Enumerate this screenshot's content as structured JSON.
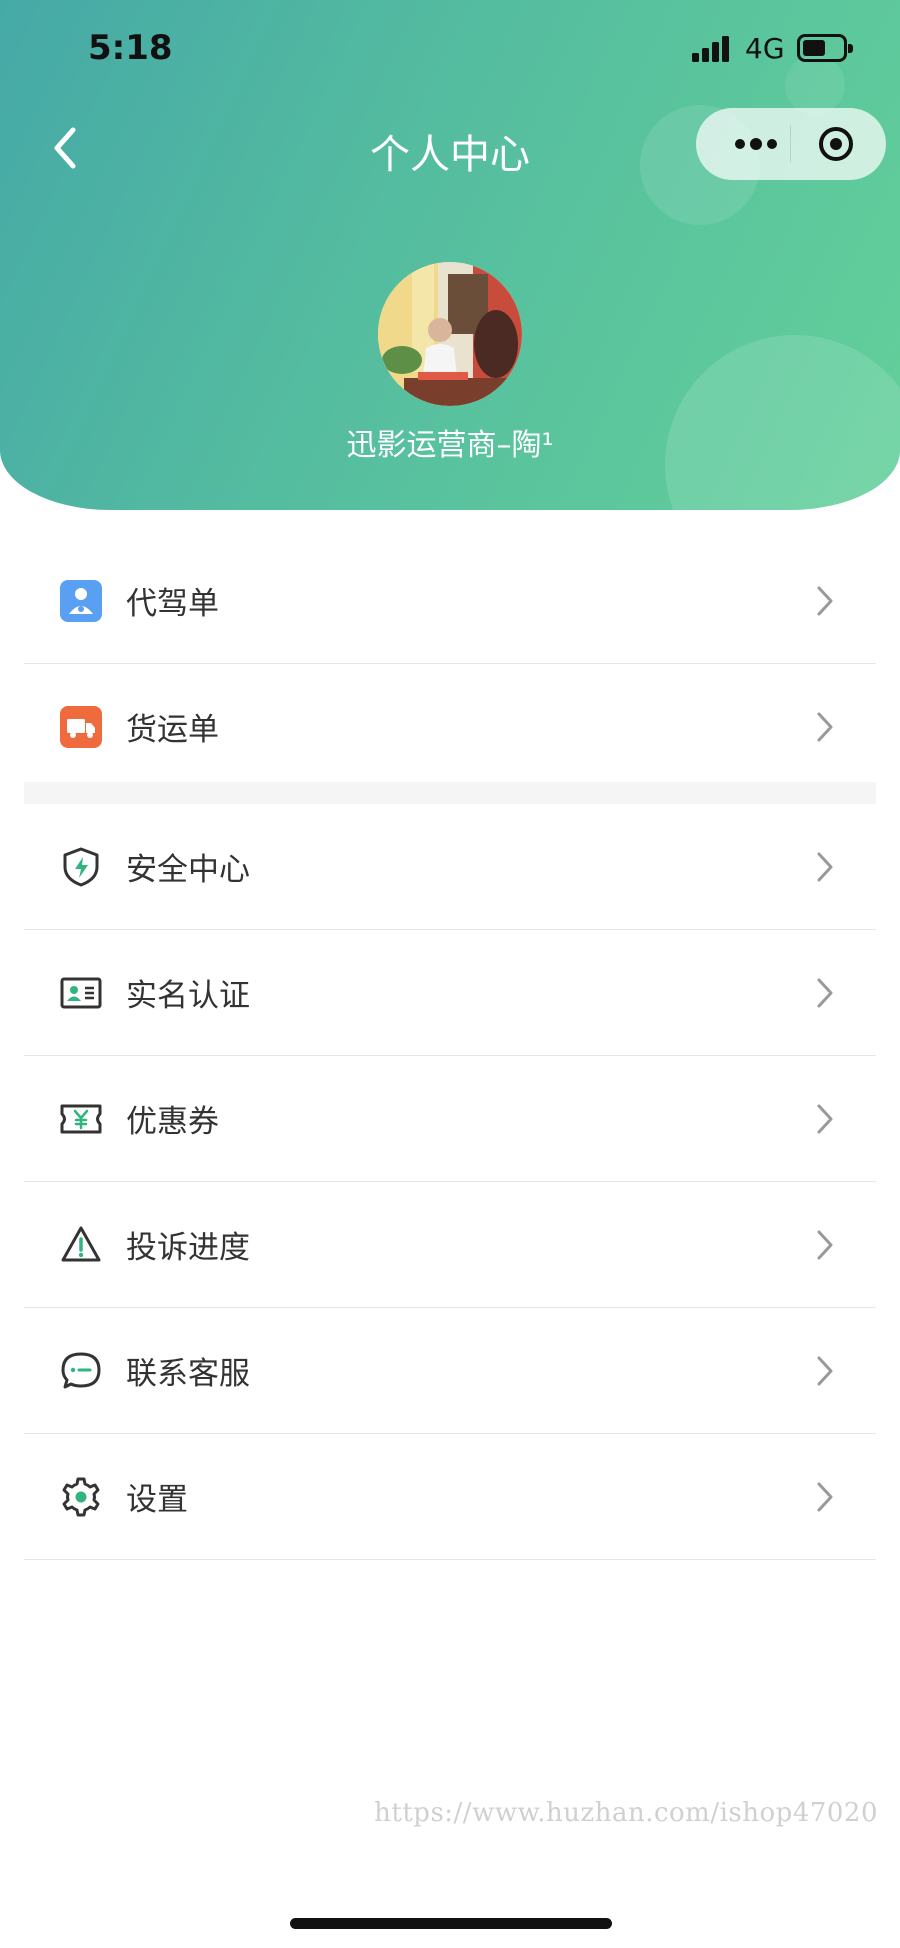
{
  "status_bar": {
    "time": "5:18",
    "network": "4G"
  },
  "header": {
    "title": "个人中心",
    "username": "迅影运营商–陶¹"
  },
  "menu_group_1": [
    {
      "label": "代驾单",
      "icon": "designated-driver-icon"
    },
    {
      "label": "货运单",
      "icon": "freight-truck-icon"
    }
  ],
  "menu_group_2": [
    {
      "label": "安全中心",
      "icon": "shield-lightning-icon"
    },
    {
      "label": "实名认证",
      "icon": "id-card-icon"
    },
    {
      "label": "优惠券",
      "icon": "coupon-yen-icon"
    },
    {
      "label": "投诉进度",
      "icon": "warning-triangle-icon"
    },
    {
      "label": "联系客服",
      "icon": "chat-bubble-icon"
    },
    {
      "label": "设置",
      "icon": "gear-icon"
    }
  ],
  "watermark": "https://www.huzhan.com/ishop47020",
  "colors": {
    "header_start": "#46a9a7",
    "header_end": "#63d09a",
    "accent": "#2fb57d"
  }
}
